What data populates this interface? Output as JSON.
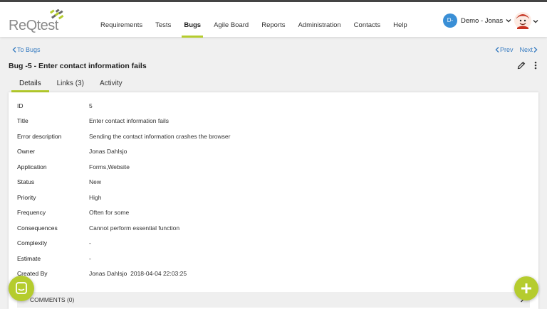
{
  "logo": {
    "text_re": "ReQ",
    "text_rest": "test"
  },
  "nav": [
    {
      "label": "Requirements",
      "active": false
    },
    {
      "label": "Tests",
      "active": false
    },
    {
      "label": "Bugs",
      "active": true
    },
    {
      "label": "Agile Board",
      "active": false
    },
    {
      "label": "Reports",
      "active": false
    },
    {
      "label": "Administration",
      "active": false
    },
    {
      "label": "Contacts",
      "active": false
    },
    {
      "label": "Help",
      "active": false
    }
  ],
  "user": {
    "initials": "D-",
    "name": "Demo - Jonas"
  },
  "back_link": "To Bugs",
  "pager": {
    "prev": "Prev",
    "next": "Next"
  },
  "page_title": "Bug -5 - Enter contact information fails",
  "tabs": [
    {
      "label": "Details",
      "active": true
    },
    {
      "label": "Links (3)",
      "active": false
    },
    {
      "label": "Activity",
      "active": false
    }
  ],
  "fields": [
    {
      "label": "ID",
      "value": "5"
    },
    {
      "label": "Title",
      "value": "Enter contact information fails"
    },
    {
      "label": "Error description",
      "value": "Sending the contact information crashes the browser"
    },
    {
      "label": "Owner",
      "value": "Jonas Dahlsjo"
    },
    {
      "label": "Application",
      "value": "Forms,Website"
    },
    {
      "label": "Status",
      "value": "New"
    },
    {
      "label": "Priority",
      "value": "High"
    },
    {
      "label": "Frequency",
      "value": "Often for some"
    },
    {
      "label": "Consequences",
      "value": "Cannot perform essential function"
    },
    {
      "label": "Complexity",
      "value": "-"
    },
    {
      "label": "Estimate",
      "value": "-"
    },
    {
      "label": "Created By",
      "value": "Jonas Dahlsjo  2018-04-04 22:03:25"
    }
  ],
  "comments": {
    "label": "COMMENTS (0)"
  },
  "icons": {
    "back": "chevron-left-icon",
    "prev": "chevron-left-icon",
    "next": "chevron-right-icon",
    "edit": "pencil-icon",
    "more": "more-vertical-icon",
    "chat": "chat-icon",
    "add": "plus-icon"
  },
  "colors": {
    "accent": "#b5cc2e",
    "link": "#3a7ec2",
    "avatar": "#3a8fd6"
  }
}
